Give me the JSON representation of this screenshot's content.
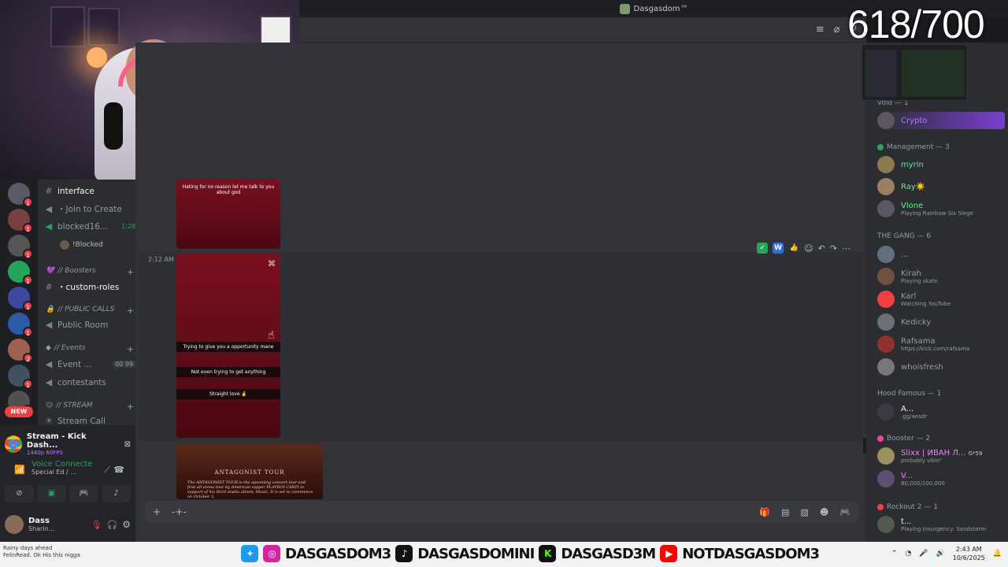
{
  "window": {
    "server_title": "Dasgasdom™"
  },
  "overlay": {
    "viewer_count": "618/700"
  },
  "channels": {
    "interface": "interface",
    "join_to_create": "・Join to Create",
    "blocked_vc": "blocked16...",
    "blocked_vc_timer": "1:28",
    "blocked_user": "!Blocked",
    "cat_boosters": "// Boosters",
    "custom_roles": "・custom-roles",
    "cat_public_calls": "// PUBLIC CALLS",
    "public_room": "Public Room",
    "cat_events": "// Events",
    "event": "Event ...",
    "event_counts": "00  99",
    "contestants": "contestants",
    "cat_stream": "// STREAM",
    "stream_call": "Stream Call"
  },
  "server_rail": {
    "badges": [
      "1",
      "1",
      "1",
      "1",
      "1",
      "1",
      "1",
      "2",
      "1",
      "1",
      "1"
    ],
    "new_label": "NEW"
  },
  "bottom_panel": {
    "stream_title": "Stream - Kick Dash...",
    "stream_quality": "1440p 60FPS",
    "voice_status": "Voice Connecte",
    "voice_channel": "Special Ed / ...",
    "username": "Dass",
    "user_status": "Sharin..."
  },
  "chat": {
    "caption_1": "Hating for no reason let me talk to you about god",
    "time_2": "2:12 AM",
    "caption_2a": "Trying to give you a opportunity mane",
    "caption_2b": "Not even trying to get anything",
    "caption_2c": "Straight love 🤞",
    "tour_title": "ANTAGONIST TOUR",
    "tour_desc": "The ANTAGONIST TOUR is the upcoming concert tour and first all-arena tour by American rapper PLAYBOI CARTI in support of his third studio album, Music. It is set to commence on October 3,"
  },
  "members": {
    "groups": [
      {
        "label": "Management — 3",
        "color": "#23a55a"
      },
      {
        "label": "THE GANG — 6",
        "color": "#949ba4"
      },
      {
        "label": "Hood Famous — 1",
        "color": "#949ba4"
      },
      {
        "label": "Booster — 2",
        "color": "#eb459e"
      },
      {
        "label": "Rockout 2 — 1",
        "color": "#f23f43"
      }
    ],
    "vold": "Void — 1",
    "crypto": "Crypto",
    "m1": "myrin",
    "m2": "Ray☀️",
    "m3": "Vlone",
    "m3_act": "Playing Rainbow Six Siege",
    "g1": "...",
    "g2": "Kirah",
    "g2_act": "Playing skate.",
    "g3": "Karl",
    "g3_act": "Watching YouTube",
    "g4": "Kedicky",
    "g5": "Rafsama",
    "g5_act": "https://kick.com/rafsama",
    "g6": "whoisfresh",
    "h1": "A...",
    "h1_act": ".gg/aesdr",
    "b1": "Slixx | ИВАН Л...",
    "b1_tag": "G*59",
    "b1_act": "probably vibin'",
    "b2": "V...",
    "b2_act": "80,000/100,000",
    "r1": "t...",
    "r1_act": "Playing Insurgency: Sandstorm"
  },
  "taskbar": {
    "left_line1": "Rainy days ahead",
    "left_line2": "FelinRead.  Ok His this nigga",
    "handle_1": "DASGASDOM3",
    "handle_2": "DASGASDOMINI",
    "handle_3": "DASGASD3M",
    "handle_4": "NOTDASGASDOM3",
    "time": "2:43 AM",
    "date": "10/6/2025"
  }
}
